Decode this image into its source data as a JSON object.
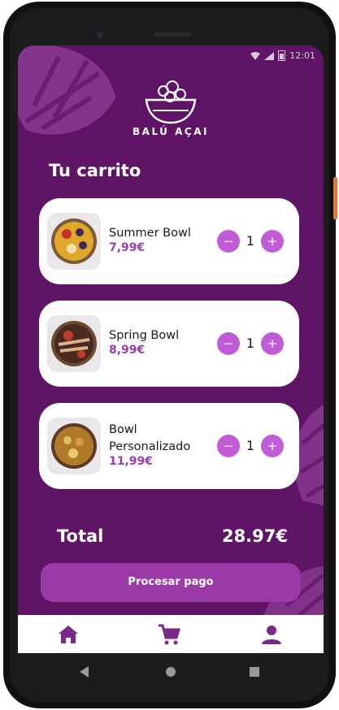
{
  "status": {
    "time": "12:01"
  },
  "brand": {
    "name": "BALÚ AÇAI"
  },
  "cart": {
    "title": "Tu carrito",
    "items": [
      {
        "name_line1": "Summer Bowl",
        "name_line2": "",
        "price": "7,99€",
        "qty": "1",
        "minus": "−",
        "plus": "+"
      },
      {
        "name_line1": "Spring Bowl",
        "name_line2": "",
        "price": "8,99€",
        "qty": "1",
        "minus": "−",
        "plus": "+"
      },
      {
        "name_line1": "Bowl",
        "name_line2": "Personalizado",
        "price": "11,99€",
        "qty": "1",
        "minus": "−",
        "plus": "+"
      }
    ],
    "total_label": "Total",
    "total_value": "28.97€",
    "pay_label": "Procesar pago"
  },
  "tabs": [
    {
      "icon": "home-icon"
    },
    {
      "icon": "cart-icon"
    },
    {
      "icon": "profile-icon"
    }
  ],
  "colors": {
    "background": "#5f1466",
    "accent": "#c25bd6",
    "price": "#9a3db0",
    "pay_button": "#9a3aa6"
  }
}
